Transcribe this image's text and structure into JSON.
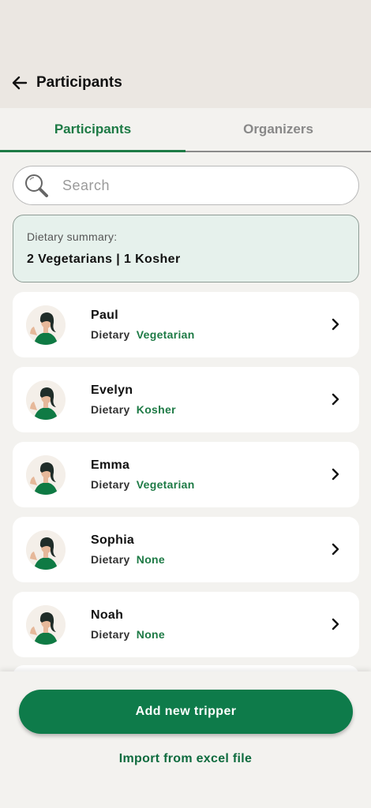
{
  "header": {
    "title": "Participants",
    "back_icon": "arrow-left-icon"
  },
  "tabs": [
    {
      "label": "Participants",
      "active": true
    },
    {
      "label": "Organizers",
      "active": false
    }
  ],
  "search": {
    "placeholder": "Search",
    "value": ""
  },
  "summary": {
    "label": "Dietary summary:",
    "value": "2 Vegetarians | 1 Kosher"
  },
  "participants": [
    {
      "name": "Paul",
      "dietary_label": "Dietary",
      "dietary": "Vegetarian"
    },
    {
      "name": "Evelyn",
      "dietary_label": "Dietary",
      "dietary": "Kosher"
    },
    {
      "name": "Emma",
      "dietary_label": "Dietary",
      "dietary": "Vegetarian"
    },
    {
      "name": "Sophia",
      "dietary_label": "Dietary",
      "dietary": "None"
    },
    {
      "name": "Noah",
      "dietary_label": "Dietary",
      "dietary": "None"
    }
  ],
  "actions": {
    "add_label": "Add new tripper",
    "import_label": "Import from excel file"
  },
  "colors": {
    "accent": "#0e7b4a",
    "summary_bg": "#e6f1ec",
    "page_bg": "#f3f2ef"
  }
}
